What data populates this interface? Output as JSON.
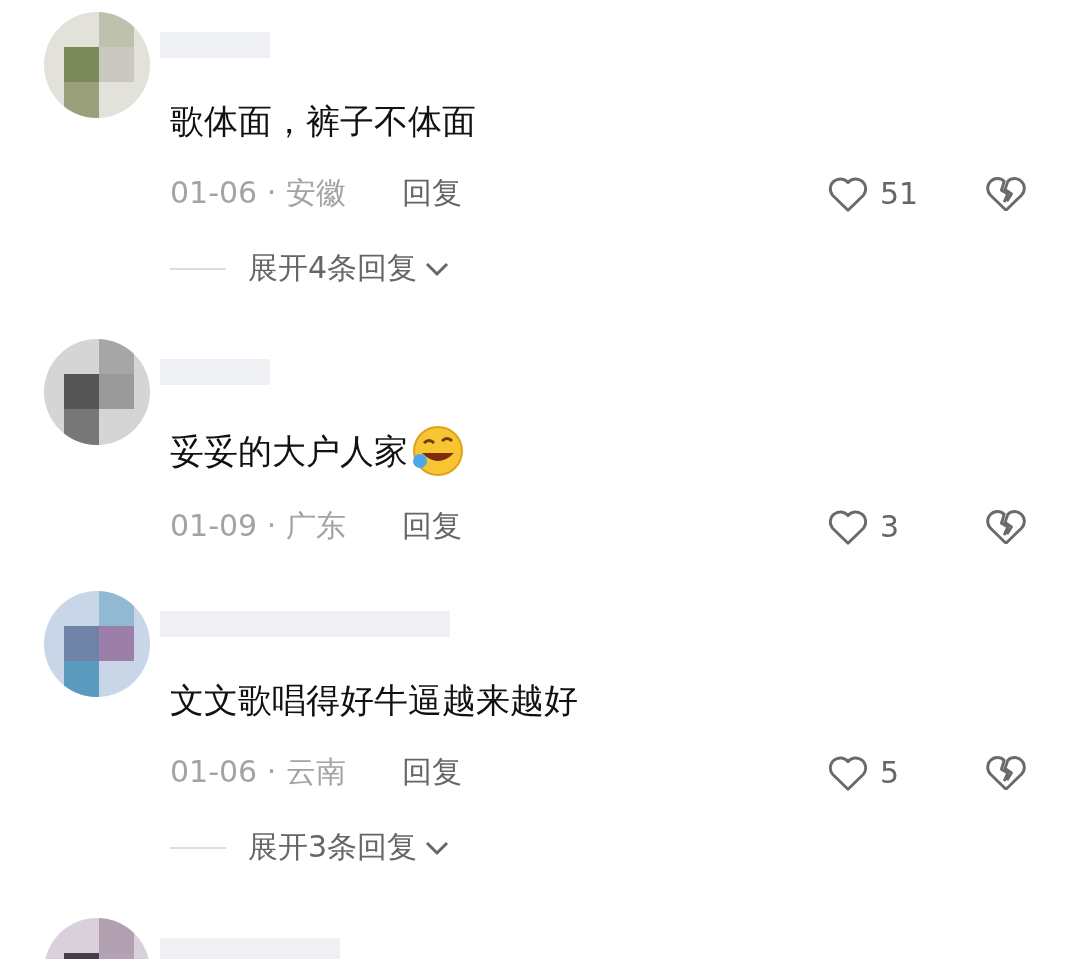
{
  "comments": [
    {
      "kind": "full",
      "text": "歌体面，裤子不体面",
      "meta": "01-06 · 安徽",
      "reply": "回复",
      "likes": "51",
      "expand": "展开4条回复"
    },
    {
      "kind": "full",
      "text": "妥妥的大户人家",
      "trailing_emoji": true,
      "meta": "01-09 · 广东",
      "reply": "回复",
      "likes": "3"
    },
    {
      "kind": "full",
      "text": "文文歌唱得好牛逼越来越好",
      "meta": "01-06 · 云南",
      "reply": "回复",
      "likes": "5",
      "expand": "展开3条回复"
    },
    {
      "kind": "cut_off"
    }
  ]
}
